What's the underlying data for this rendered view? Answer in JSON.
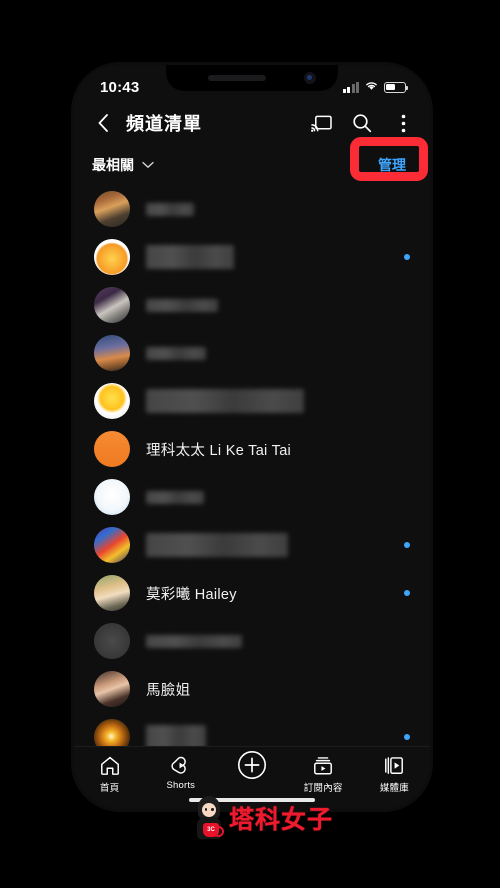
{
  "status_bar": {
    "time": "10:43",
    "signal_icon": "cellular-signal-icon",
    "signal_bars_total": 4,
    "signal_bars_active": 2,
    "wifi_icon": "wifi-icon",
    "battery_icon": "battery-icon",
    "battery_level_percent": 44
  },
  "header": {
    "back_icon": "chevron-left-icon",
    "title": "頻道清單",
    "cast_icon": "cast-icon",
    "search_icon": "search-icon",
    "overflow_icon": "more-vertical-icon"
  },
  "sort_row": {
    "sort_label": "最相關",
    "sort_chevron_icon": "chevron-down-icon",
    "manage_label": "管理",
    "manage_color": "#3ea6ff",
    "highlight_color": "#fb2c36"
  },
  "channels": [
    {
      "name": "",
      "redacted": true,
      "name_width": 48,
      "lines": 1,
      "unread": false,
      "avatar": "autumn-park-photo"
    },
    {
      "name": "",
      "redacted": true,
      "name_width": 88,
      "lines": 2,
      "unread": true,
      "avatar": "orange-pyramid-logo"
    },
    {
      "name": "",
      "redacted": true,
      "name_width": 72,
      "lines": 1,
      "unread": false,
      "avatar": "husky-dogs-photo"
    },
    {
      "name": "",
      "redacted": true,
      "name_width": 60,
      "lines": 1,
      "unread": false,
      "avatar": "sunset-bridge-photo"
    },
    {
      "name": "",
      "redacted": true,
      "name_width": 158,
      "lines": 2,
      "unread": false,
      "avatar": "yellow-cartoon-logo"
    },
    {
      "name": "理科太太 Li Ke Tai Tai",
      "redacted": false,
      "name_width": 0,
      "lines": 1,
      "unread": false,
      "avatar": "orange-text-logo"
    },
    {
      "name": "",
      "redacted": true,
      "name_width": 58,
      "lines": 1,
      "unread": false,
      "avatar": "white-cartoon-logo"
    },
    {
      "name": "",
      "redacted": true,
      "name_width": 142,
      "lines": 2,
      "unread": true,
      "avatar": "face-paint-photo"
    },
    {
      "name": "莫彩曦 Hailey",
      "redacted": false,
      "name_width": 0,
      "lines": 1,
      "unread": true,
      "avatar": "blonde-woman-photo"
    },
    {
      "name": "",
      "redacted": true,
      "name_width": 96,
      "lines": 1,
      "unread": false,
      "avatar": "epic-success-logo"
    },
    {
      "name": "馬臉姐",
      "redacted": false,
      "name_width": 0,
      "lines": 1,
      "unread": false,
      "avatar": "dark-hair-woman-photo"
    },
    {
      "name": "",
      "redacted": true,
      "name_width": 60,
      "lines": 2,
      "unread": true,
      "avatar": "golden-burst-photo"
    },
    {
      "name": "",
      "redacted": true,
      "name_width": 60,
      "lines": 1,
      "unread": false,
      "avatar": "partial-photo"
    }
  ],
  "bottom_nav": [
    {
      "label": "首頁",
      "icon": "home-icon"
    },
    {
      "label": "Shorts",
      "icon": "shorts-icon"
    },
    {
      "label": "",
      "icon": "create-plus-icon"
    },
    {
      "label": "訂閱內容",
      "icon": "subscriptions-icon"
    },
    {
      "label": "媒體庫",
      "icon": "library-icon"
    }
  ],
  "watermark": {
    "text": "塔科女子",
    "mascot_icon": "girl-with-mug-mascot",
    "mug_text": "3C",
    "color": "#ee1b2e"
  },
  "device": {
    "notch_speaker_icon": "speaker-grille",
    "notch_camera_icon": "front-camera-icon",
    "home_indicator_icon": "home-indicator-bar"
  }
}
